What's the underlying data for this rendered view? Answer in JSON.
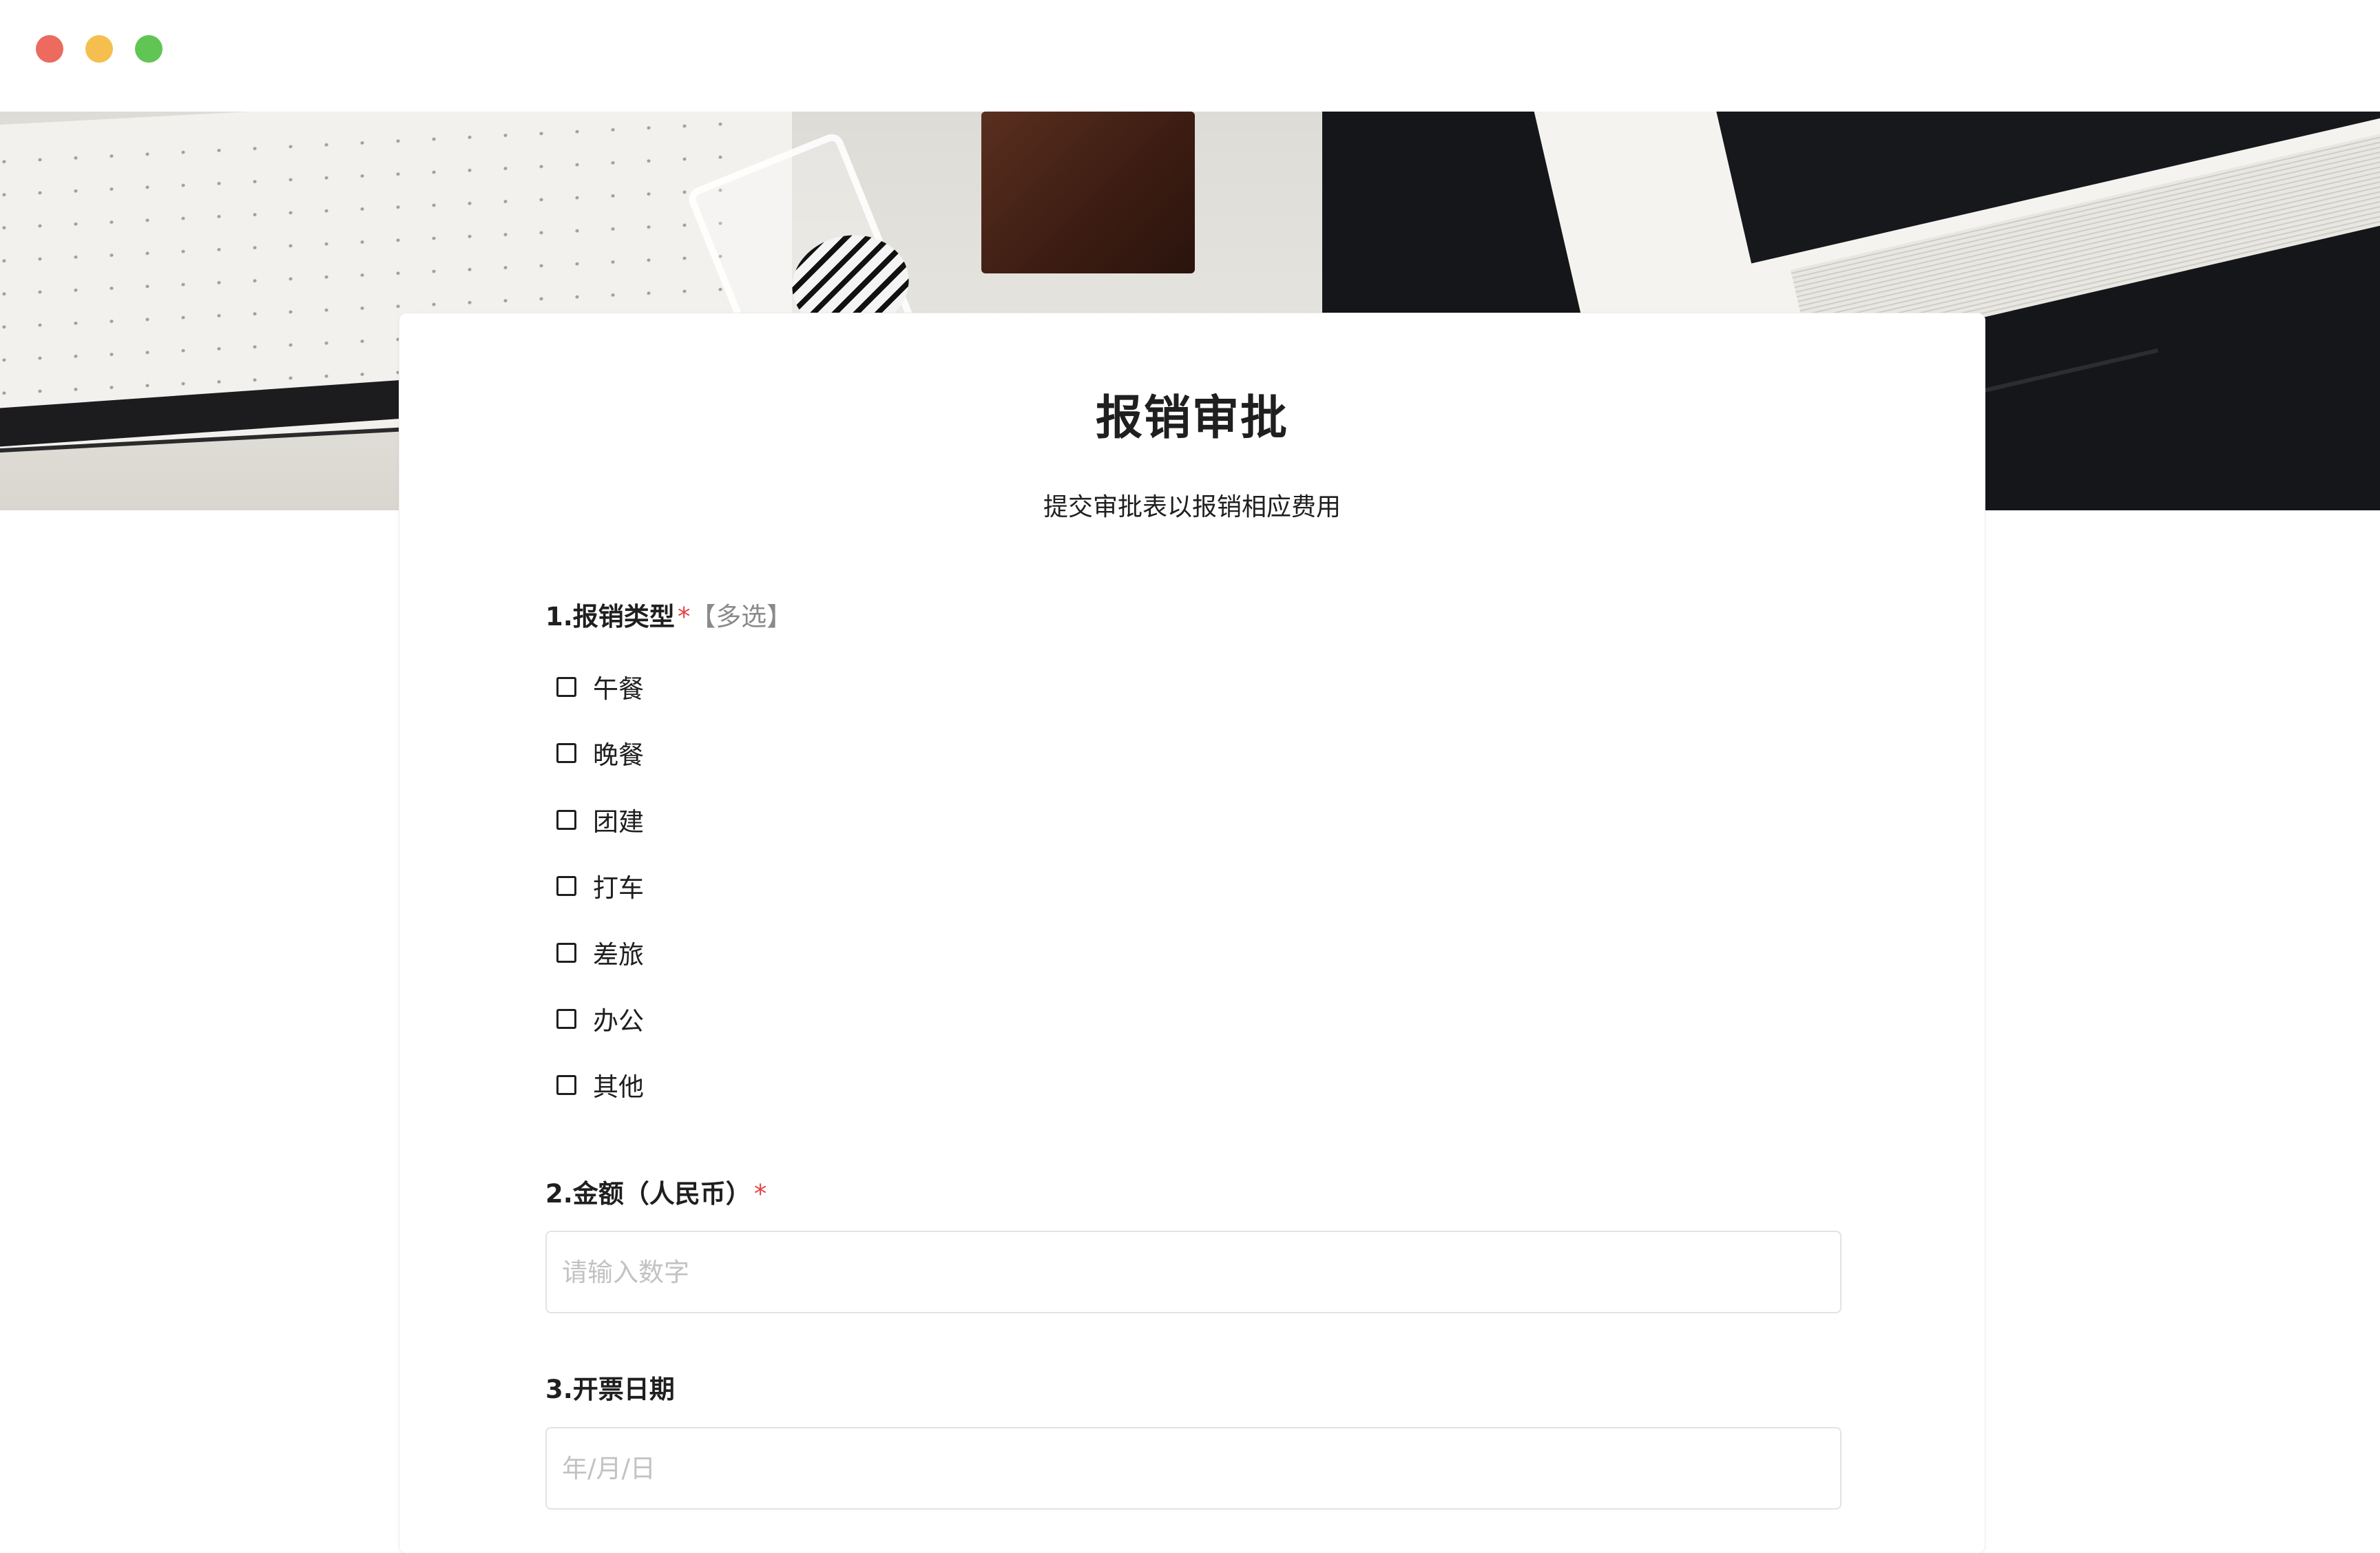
{
  "window": {
    "controls": [
      "close",
      "minimize",
      "maximize"
    ],
    "colors": {
      "close": "#ed6a5e",
      "minimize": "#f5bf4f",
      "maximize": "#61c554"
    }
  },
  "banner": {
    "image": "desk-photo"
  },
  "form": {
    "title": "报销审批",
    "description": "提交审批表以报销相应费用",
    "questions": [
      {
        "label": "1.报销类型",
        "required_mark": "*",
        "type_tag": "【多选】",
        "options": [
          "午餐",
          "晚餐",
          "团建",
          "打车",
          "差旅",
          "办公",
          "其他"
        ]
      },
      {
        "label": "2.金额（人民币）",
        "required_mark": "*",
        "placeholder": "请输入数字"
      },
      {
        "label": "3.开票日期",
        "placeholder": "年/月/日"
      }
    ]
  },
  "colors": {
    "required": "#e54545",
    "text": "#1f1f1f",
    "placeholder": "#c2c2c2",
    "border": "#e3e3e3"
  }
}
